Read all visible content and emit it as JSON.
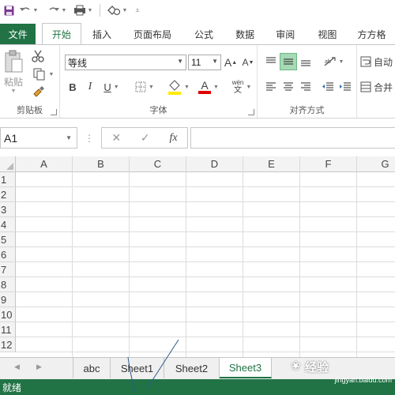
{
  "qat": {
    "icons": [
      "save-icon",
      "undo-icon",
      "redo-icon",
      "print-preview-icon",
      "shape-icon",
      "customize-icon"
    ]
  },
  "tabs": [
    "文件",
    "开始",
    "插入",
    "页面布局",
    "公式",
    "数据",
    "审阅",
    "视图",
    "方方格"
  ],
  "active_tab": "开始",
  "ribbon": {
    "clipboard": {
      "paste_label": "粘贴",
      "group_label": "剪贴板"
    },
    "font": {
      "font_name": "等线",
      "font_size": "11",
      "bold": "B",
      "italic": "I",
      "underline": "U",
      "font_color_glyph": "A",
      "phonetic_top": "wén",
      "phonetic_bottom": "文",
      "grow_glyph": "A",
      "shrink_glyph": "A",
      "group_label": "字体"
    },
    "alignment": {
      "group_label": "对齐方式",
      "wrap_label": "自动",
      "merge_label": "合并"
    }
  },
  "formula_bar": {
    "name_box": "A1",
    "cancel_glyph": "✕",
    "enter_glyph": "✓",
    "fx_glyph": "fx",
    "value": ""
  },
  "columns": [
    "A",
    "B",
    "C",
    "D",
    "E",
    "F",
    "G"
  ],
  "rows": [
    "1",
    "2",
    "3",
    "4",
    "5",
    "6",
    "7",
    "8",
    "9",
    "10",
    "11",
    "12"
  ],
  "sheets": [
    "abc",
    "Sheet1",
    "Sheet2",
    "Sheet3"
  ],
  "active_sheet": "Sheet3",
  "status": "就绪",
  "watermark": {
    "brand": "经验",
    "url": "jingyan.baidu.com"
  },
  "colors": {
    "accent": "#217346"
  }
}
